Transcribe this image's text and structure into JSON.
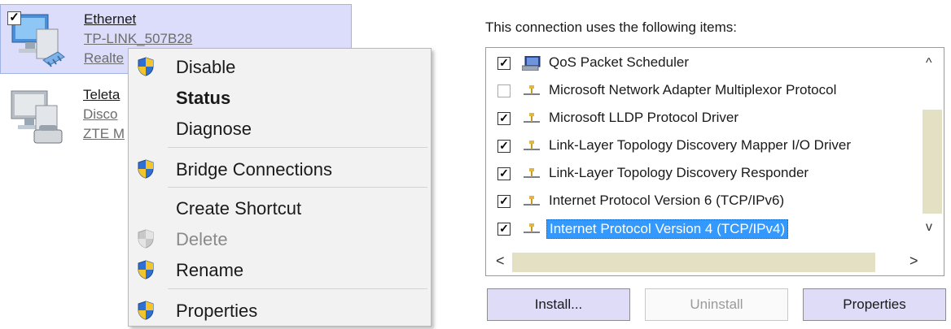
{
  "connections": [
    {
      "name": "Ethernet",
      "line1": "TP-LINK_507B28",
      "line2": "Realte",
      "checked": true,
      "selected": true
    },
    {
      "name": "Teleta",
      "line1": "Disco",
      "line2": "ZTE M",
      "checked": false,
      "selected": false
    }
  ],
  "context_menu": {
    "items": [
      {
        "label": "Disable",
        "shield": true
      },
      {
        "label": "Status",
        "bold": true
      },
      {
        "label": "Diagnose"
      },
      {
        "label": "Bridge Connections",
        "shield": true
      },
      {
        "label": "Create Shortcut"
      },
      {
        "label": "Delete",
        "shield": true,
        "disabled": true
      },
      {
        "label": "Rename",
        "shield": true
      },
      {
        "label": "Properties",
        "shield": true
      }
    ]
  },
  "items_panel": {
    "heading": "This connection uses the following items:",
    "items": [
      {
        "label": "QoS Packet Scheduler",
        "checked": true,
        "icon": "scheduler-icon"
      },
      {
        "label": "Microsoft Network Adapter Multiplexor Protocol",
        "checked": false,
        "icon": "protocol-icon"
      },
      {
        "label": "Microsoft LLDP Protocol Driver",
        "checked": true,
        "icon": "protocol-icon"
      },
      {
        "label": "Link-Layer Topology Discovery Mapper I/O Driver",
        "checked": true,
        "icon": "protocol-icon"
      },
      {
        "label": "Link-Layer Topology Discovery Responder",
        "checked": true,
        "icon": "protocol-icon"
      },
      {
        "label": "Internet Protocol Version 6 (TCP/IPv6)",
        "checked": true,
        "icon": "protocol-icon"
      },
      {
        "label": "Internet Protocol Version 4 (TCP/IPv4)",
        "checked": true,
        "icon": "protocol-icon",
        "selected": true
      }
    ],
    "scroll_up": "^",
    "scroll_down": "v",
    "scroll_left": "<",
    "scroll_right": ">"
  },
  "buttons": {
    "install": "Install...",
    "uninstall": "Uninstall",
    "properties": "Properties"
  },
  "colors": {
    "selection": "#3399ff",
    "menu_bg": "#f2f2f2",
    "button_bg": "#dedcf6",
    "scroll_thumb": "#e3e0c4"
  }
}
